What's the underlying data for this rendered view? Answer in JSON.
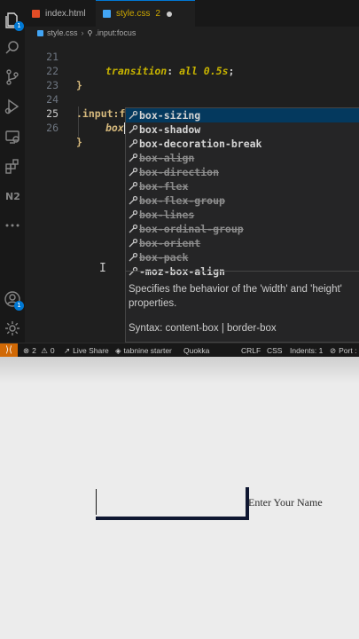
{
  "tabs": [
    {
      "label": "index.html",
      "icon": "html-file-icon"
    },
    {
      "label": "style.css",
      "icon": "css-file-icon",
      "problems": "2"
    }
  ],
  "breadcrumb": [
    "style.css",
    ".input:focus"
  ],
  "code_lines": [
    {
      "num": "21",
      "text": "transition: all 0.5s;"
    },
    {
      "num": "22",
      "text": "}"
    },
    {
      "num": "23",
      "text": ""
    },
    {
      "num": "24",
      "text": ".input:focus {"
    },
    {
      "num": "25",
      "text": "box"
    },
    {
      "num": "26",
      "text": "}"
    }
  ],
  "suggestions": [
    {
      "label": "box-sizing",
      "deprecated": false,
      "selected": true
    },
    {
      "label": "box-shadow",
      "deprecated": false,
      "selected": false
    },
    {
      "label": "box-decoration-break",
      "deprecated": false,
      "selected": false
    },
    {
      "label": "box-align",
      "deprecated": true,
      "selected": false
    },
    {
      "label": "box-direction",
      "deprecated": true,
      "selected": false
    },
    {
      "label": "box-flex",
      "deprecated": true,
      "selected": false
    },
    {
      "label": "box-flex-group",
      "deprecated": true,
      "selected": false
    },
    {
      "label": "box-lines",
      "deprecated": true,
      "selected": false
    },
    {
      "label": "box-ordinal-group",
      "deprecated": true,
      "selected": false
    },
    {
      "label": "box-orient",
      "deprecated": true,
      "selected": false
    },
    {
      "label": "box-pack",
      "deprecated": true,
      "selected": false
    },
    {
      "label": "-moz-box-align",
      "deprecated": false,
      "selected": false
    }
  ],
  "suggestion_details": {
    "description": "Specifies the behavior of the 'width' and 'height' properties.",
    "syntax": "Syntax: content-box | border-box"
  },
  "activity_bar": [
    {
      "icon": "explorer-icon",
      "badge": "1"
    },
    {
      "icon": "search-icon"
    },
    {
      "icon": "source-control-icon"
    },
    {
      "icon": "run-debug-icon"
    },
    {
      "icon": "remote-explorer-icon"
    },
    {
      "icon": "extensions-icon"
    },
    {
      "icon": "n2-icon",
      "text": "N2"
    },
    {
      "icon": "more-icon"
    },
    {
      "icon": "account-icon",
      "badge": "1"
    },
    {
      "icon": "settings-icon"
    }
  ],
  "status_bar": {
    "errors": "2",
    "warnings": "0",
    "live_share": "Live Share",
    "tabnine": "tabnine starter",
    "quokka": "Quokka",
    "line_ending": "CRLF",
    "language": "CSS",
    "indents": "Indents: 1",
    "port": "Port :"
  },
  "preview": {
    "input_label": "Enter Your Name"
  },
  "colors": {
    "editor_bg": "#1f1f1f",
    "remote_button": "#d16905",
    "selected_suggestion": "#04395e",
    "input_border": "#0f1731"
  }
}
